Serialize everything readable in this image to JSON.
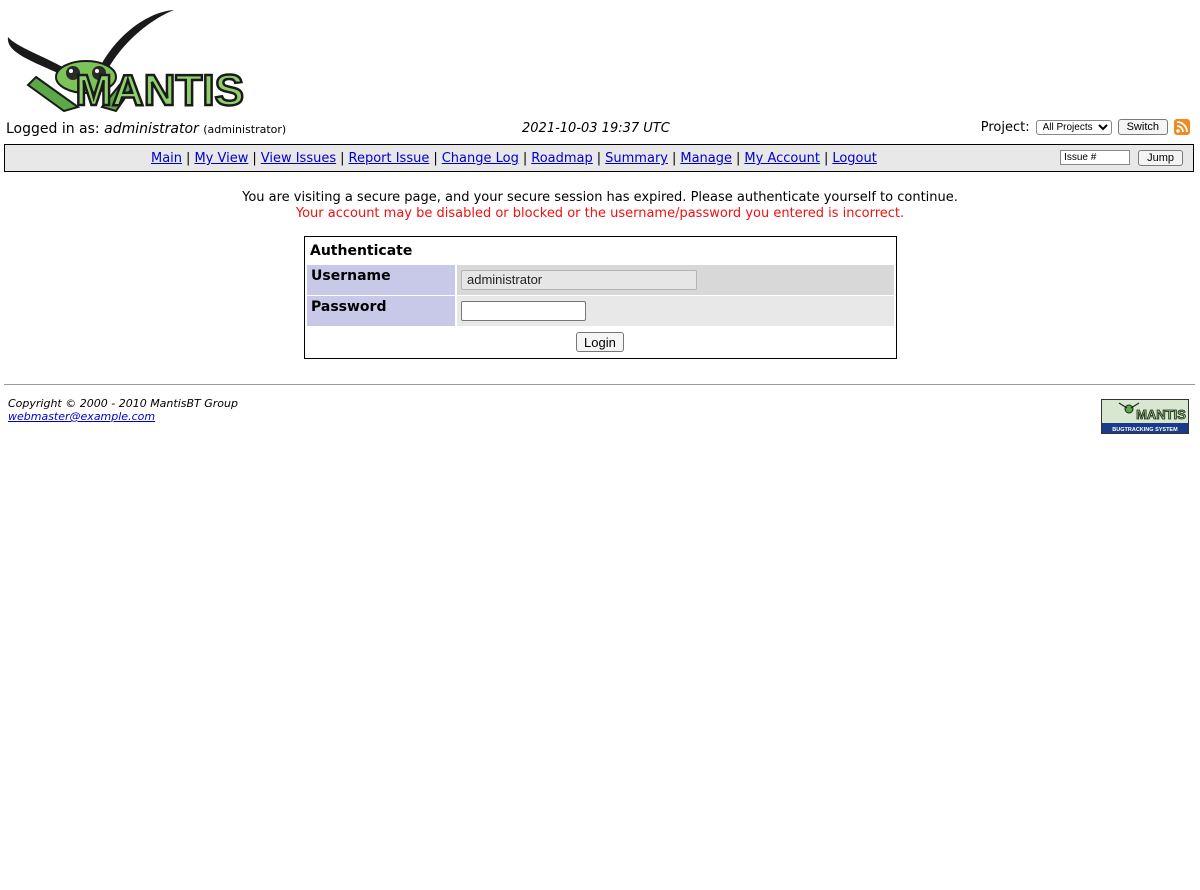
{
  "logo": {
    "name": "MANTIS"
  },
  "header": {
    "logged_in_prefix": "Logged in as: ",
    "username": "administrator",
    "role": "(administrator)",
    "datetime": "2021-10-03 19:37 UTC",
    "project_label": "Project:",
    "project_selected": "All Projects",
    "switch_label": "Switch"
  },
  "menu": {
    "items": [
      "Main",
      "My View",
      "View Issues",
      "Report Issue",
      "Change Log",
      "Roadmap",
      "Summary",
      "Manage",
      "My Account",
      "Logout"
    ],
    "separator": "|",
    "issue_placeholder": "Issue #",
    "jump_label": "Jump"
  },
  "messages": {
    "info": "You are visiting a secure page, and your secure session has expired. Please authenticate yourself to continue.",
    "error": "Your account may be disabled or blocked or the username/password you entered is incorrect."
  },
  "auth": {
    "title": "Authenticate",
    "username_label": "Username",
    "username_value": "administrator",
    "password_label": "Password",
    "password_value": "",
    "login_label": "Login"
  },
  "footer": {
    "copyright": "Copyright © 2000 - 2010 MantisBT Group",
    "email": "webmaster@example.com",
    "badge_line1": "MANTIS",
    "badge_line2": "BUGTRACKING SYSTEM"
  },
  "colors": {
    "menu_bg": "#e8e8e8",
    "label_bg": "#c8c8e8",
    "error_text": "#ee1111",
    "link": "#0000cc",
    "logo_green": "#5aa848"
  }
}
